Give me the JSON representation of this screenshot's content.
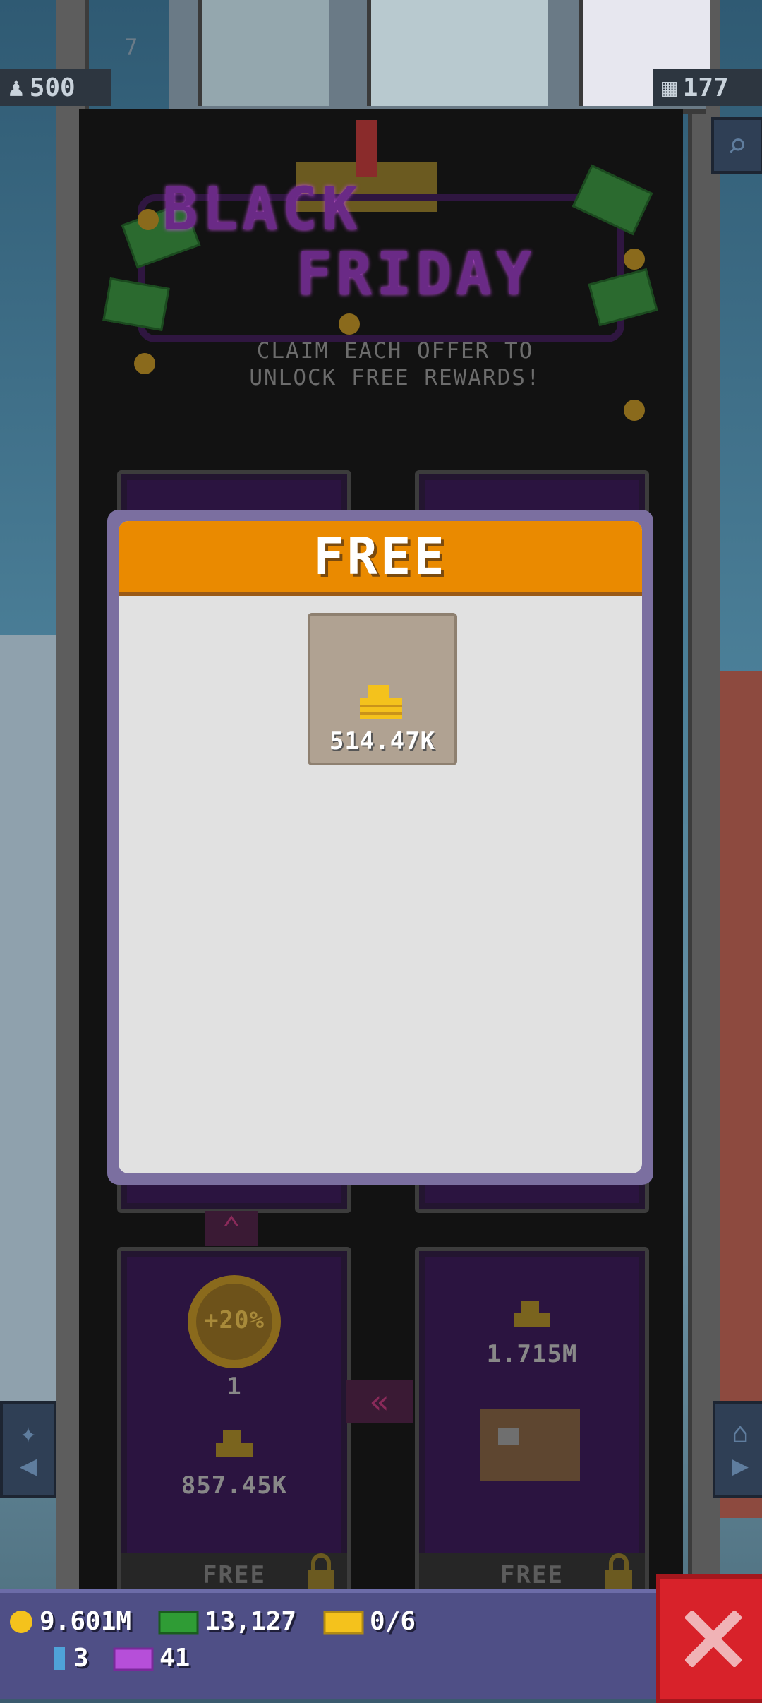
{
  "top_bar": {
    "population": "500",
    "floors": "177",
    "floor_number": "7"
  },
  "promo": {
    "title_line1": "BLACK",
    "title_line2": "FRIDAY",
    "subtitle_line1": "CLAIM EACH OFFER TO",
    "subtitle_line2": "UNLOCK FREE REWARDS!"
  },
  "popup": {
    "header": "FREE",
    "reward_amount": "514.47K",
    "reward_icon": "coin-stack-icon",
    "chest_icon": "wooden-crate-icon"
  },
  "offers": [
    {
      "boost_label": "+20%",
      "count": "1",
      "coins": "857.45K",
      "footer": "FREE"
    },
    {
      "coins": "1.715M",
      "footer": "FREE"
    }
  ],
  "resources": {
    "coins": "9.601M",
    "bux": "13,127",
    "tickets": "0/6",
    "keys": "3",
    "golden_tickets": "41"
  },
  "colors": {
    "header_orange": "#ea8a00",
    "close_red": "#d8222a",
    "resbar_purple": "#4f4f86"
  }
}
